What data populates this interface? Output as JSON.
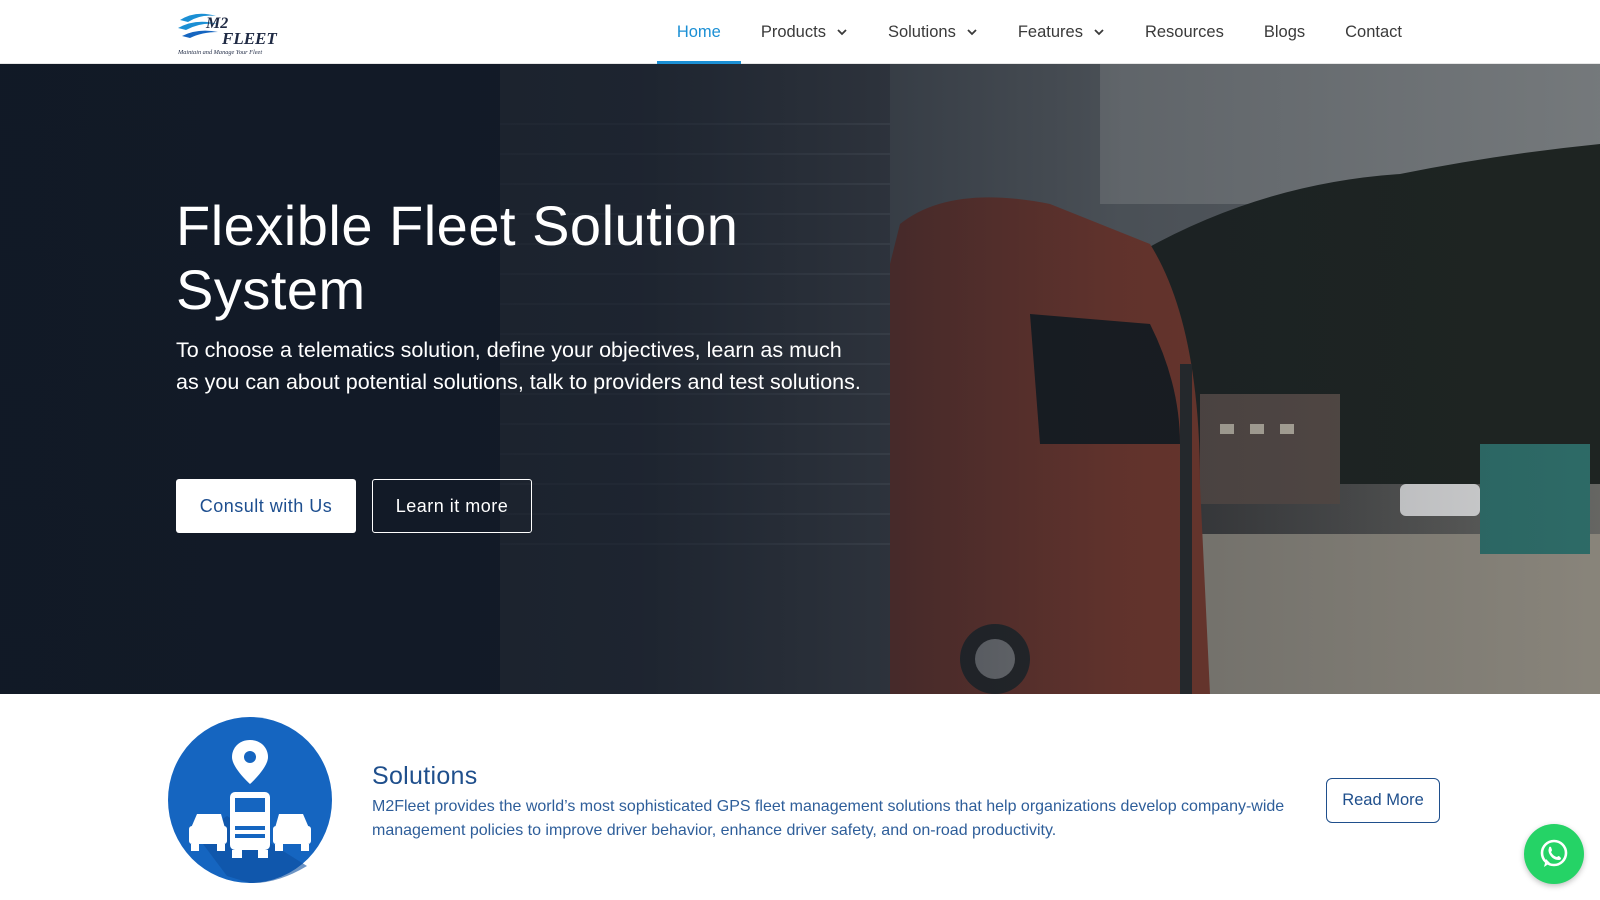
{
  "header": {
    "logo": {
      "brand_line1": "M2",
      "brand_line2": "FLEET",
      "tagline": "Maintain and Manage Your Fleet"
    },
    "nav": [
      {
        "label": "Home",
        "active": true
      },
      {
        "label": "Products",
        "dropdown": true
      },
      {
        "label": "Solutions",
        "dropdown": true
      },
      {
        "label": "Features",
        "dropdown": true
      },
      {
        "label": "Resources"
      },
      {
        "label": "Blogs"
      },
      {
        "label": "Contact"
      }
    ]
  },
  "hero": {
    "title_line1": "Flexible Fleet Solution",
    "title_line2": "System",
    "subtitle": "To choose a telematics solution, define your objectives, learn as much as you can about potential solutions, talk to providers and test solutions.",
    "primary_button": "Consult with Us",
    "secondary_button": "Learn it more"
  },
  "solutions": {
    "title": "Solutions",
    "description": "M2Fleet provides the world’s most sophisticated GPS fleet management solutions that help organizations develop company-wide management policies to improve driver behavior, enhance driver safety, and on-road productivity.",
    "read_more": "Read More",
    "icon": "location-truck-icon"
  },
  "floating": {
    "icon": "whatsapp-icon"
  },
  "colors": {
    "accent": "#1b8fd4",
    "brand_blue": "#1f4f8c",
    "hero_dark": "#141d2b",
    "icon_circle": "#1565c0",
    "whatsapp": "#25d366"
  }
}
